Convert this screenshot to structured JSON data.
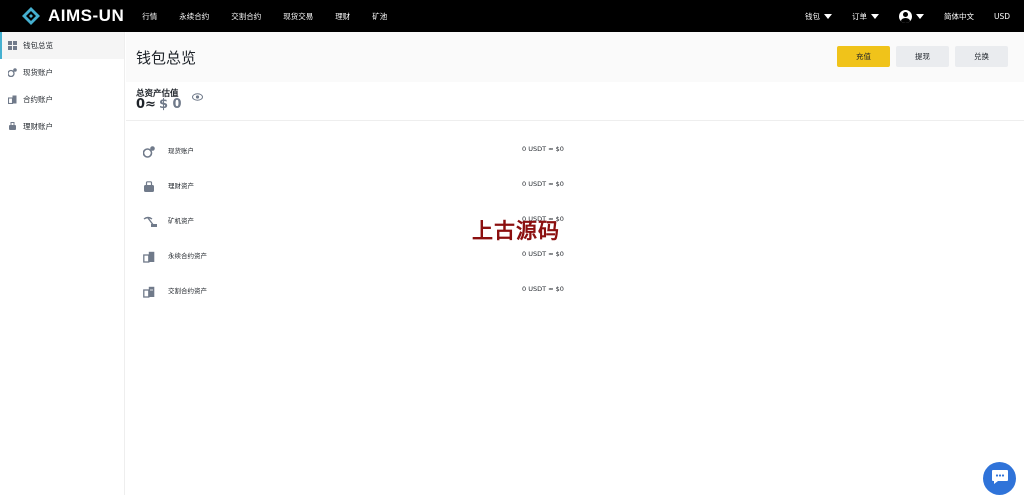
{
  "header": {
    "logo_text": "AIMS-UN",
    "nav": [
      "行情",
      "永续合约",
      "交割合约",
      "现货交易",
      "理财",
      "矿池"
    ],
    "right": {
      "wallet": "钱包",
      "orders": "订单",
      "language": "简体中文",
      "currency": "USD"
    }
  },
  "sidebar": {
    "items": [
      {
        "label": "钱包总览",
        "icon": "grid-icon",
        "active": true
      },
      {
        "label": "现货账户",
        "icon": "spot-icon",
        "active": false
      },
      {
        "label": "合约账户",
        "icon": "contract-icon",
        "active": false
      },
      {
        "label": "理财账户",
        "icon": "finance-icon",
        "active": false
      }
    ]
  },
  "main": {
    "title": "钱包总览",
    "buttons": {
      "deposit": "充值",
      "withdraw": "提现",
      "exchange": "兑换"
    },
    "total": {
      "label": "总资产估值",
      "value": "0≈",
      "usd": "$ 0"
    },
    "accounts": [
      {
        "name": "现货账户",
        "value": "0 USDT ≈ $0",
        "icon": "spot-icon"
      },
      {
        "name": "理财资产",
        "value": "0 USDT ≈ $0",
        "icon": "finance-icon"
      },
      {
        "name": "矿机资产",
        "value": "0 USDT ≈ $0",
        "icon": "mining-icon"
      },
      {
        "name": "永续合约资产",
        "value": "0 USDT ≈ $0",
        "icon": "perpetual-icon"
      },
      {
        "name": "交割合约资产",
        "value": "0 USDT ≈ $0",
        "icon": "delivery-icon"
      }
    ]
  },
  "watermark": "上古源码",
  "colors": {
    "accent": "#f0c31a",
    "brand": "#45b0d0",
    "chat": "#2f73d9",
    "watermark": "#8b0f0f"
  }
}
